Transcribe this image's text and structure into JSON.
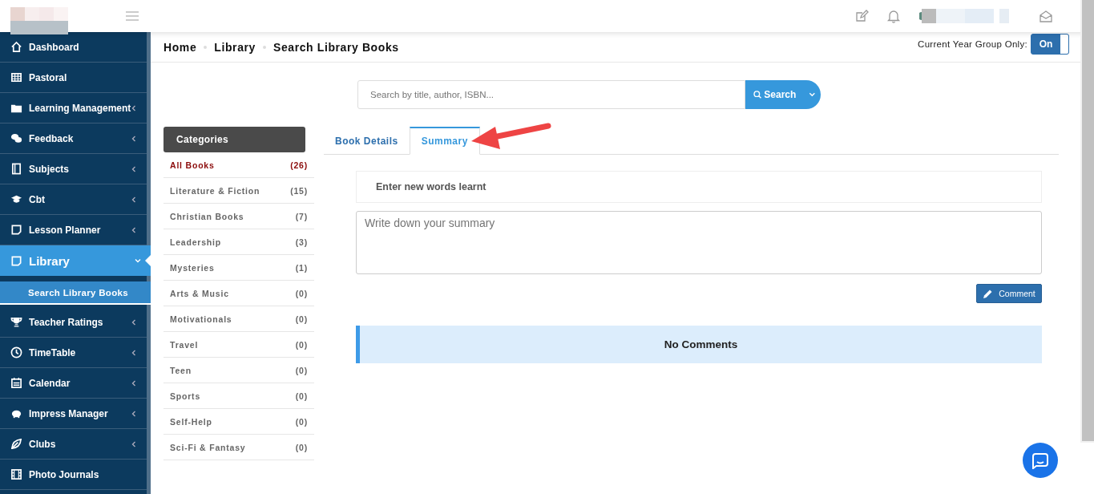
{
  "sidebar": {
    "items": [
      {
        "label": "Dashboard",
        "expandable": false,
        "selected": false,
        "expanded": false
      },
      {
        "label": "Pastoral",
        "expandable": false,
        "selected": false,
        "expanded": false
      },
      {
        "label": "Learning Management",
        "expandable": true,
        "selected": false,
        "expanded": false
      },
      {
        "label": "Feedback",
        "expandable": true,
        "selected": false,
        "expanded": false
      },
      {
        "label": "Subjects",
        "expandable": true,
        "selected": false,
        "expanded": false
      },
      {
        "label": "Cbt",
        "expandable": true,
        "selected": false,
        "expanded": false
      },
      {
        "label": "Lesson Planner",
        "expandable": true,
        "selected": false,
        "expanded": false
      },
      {
        "label": "Library",
        "expandable": true,
        "selected": true,
        "expanded": true,
        "children": [
          {
            "label": "Search Library Books",
            "selected": true
          }
        ]
      },
      {
        "label": "Teacher Ratings",
        "expandable": true,
        "selected": false,
        "expanded": false
      },
      {
        "label": "TimeTable",
        "expandable": true,
        "selected": false,
        "expanded": false
      },
      {
        "label": "Calendar",
        "expandable": true,
        "selected": false,
        "expanded": false
      },
      {
        "label": "Impress Manager",
        "expandable": true,
        "selected": false,
        "expanded": false
      },
      {
        "label": "Clubs",
        "expandable": true,
        "selected": false,
        "expanded": false
      },
      {
        "label": "Photo Journals",
        "expandable": false,
        "selected": false,
        "expanded": false
      }
    ]
  },
  "breadcrumb": [
    "Home",
    "Library",
    "Search Library Books"
  ],
  "year_toggle": {
    "label": "Current Year Group Only:",
    "value": "On",
    "on": true
  },
  "search": {
    "placeholder": "Search by title, author, ISBN...",
    "button": "Search"
  },
  "categories": {
    "title": "Categories",
    "items": [
      {
        "label": "All Books",
        "count": "(26)",
        "selected": true
      },
      {
        "label": "Literature & Fiction",
        "count": "(15)",
        "selected": false
      },
      {
        "label": "Christian Books",
        "count": "(7)",
        "selected": false
      },
      {
        "label": "Leadership",
        "count": "(3)",
        "selected": false
      },
      {
        "label": "Mysteries",
        "count": "(1)",
        "selected": false
      },
      {
        "label": "Arts & Music",
        "count": "(0)",
        "selected": false
      },
      {
        "label": "Motivationals",
        "count": "(0)",
        "selected": false
      },
      {
        "label": "Travel",
        "count": "(0)",
        "selected": false
      },
      {
        "label": "Teen",
        "count": "(0)",
        "selected": false
      },
      {
        "label": "Sports",
        "count": "(0)",
        "selected": false
      },
      {
        "label": "Self-Help",
        "count": "(0)",
        "selected": false
      },
      {
        "label": "Sci-Fi & Fantasy",
        "count": "(0)",
        "selected": false
      }
    ]
  },
  "tabs": [
    {
      "label": "Book Details",
      "selected": false
    },
    {
      "label": "Summary",
      "selected": true
    }
  ],
  "words_heading": "Enter new words learnt",
  "summary": {
    "placeholder": "Write down your summary"
  },
  "comment_button": "Comment",
  "comments_notice": "No Comments"
}
